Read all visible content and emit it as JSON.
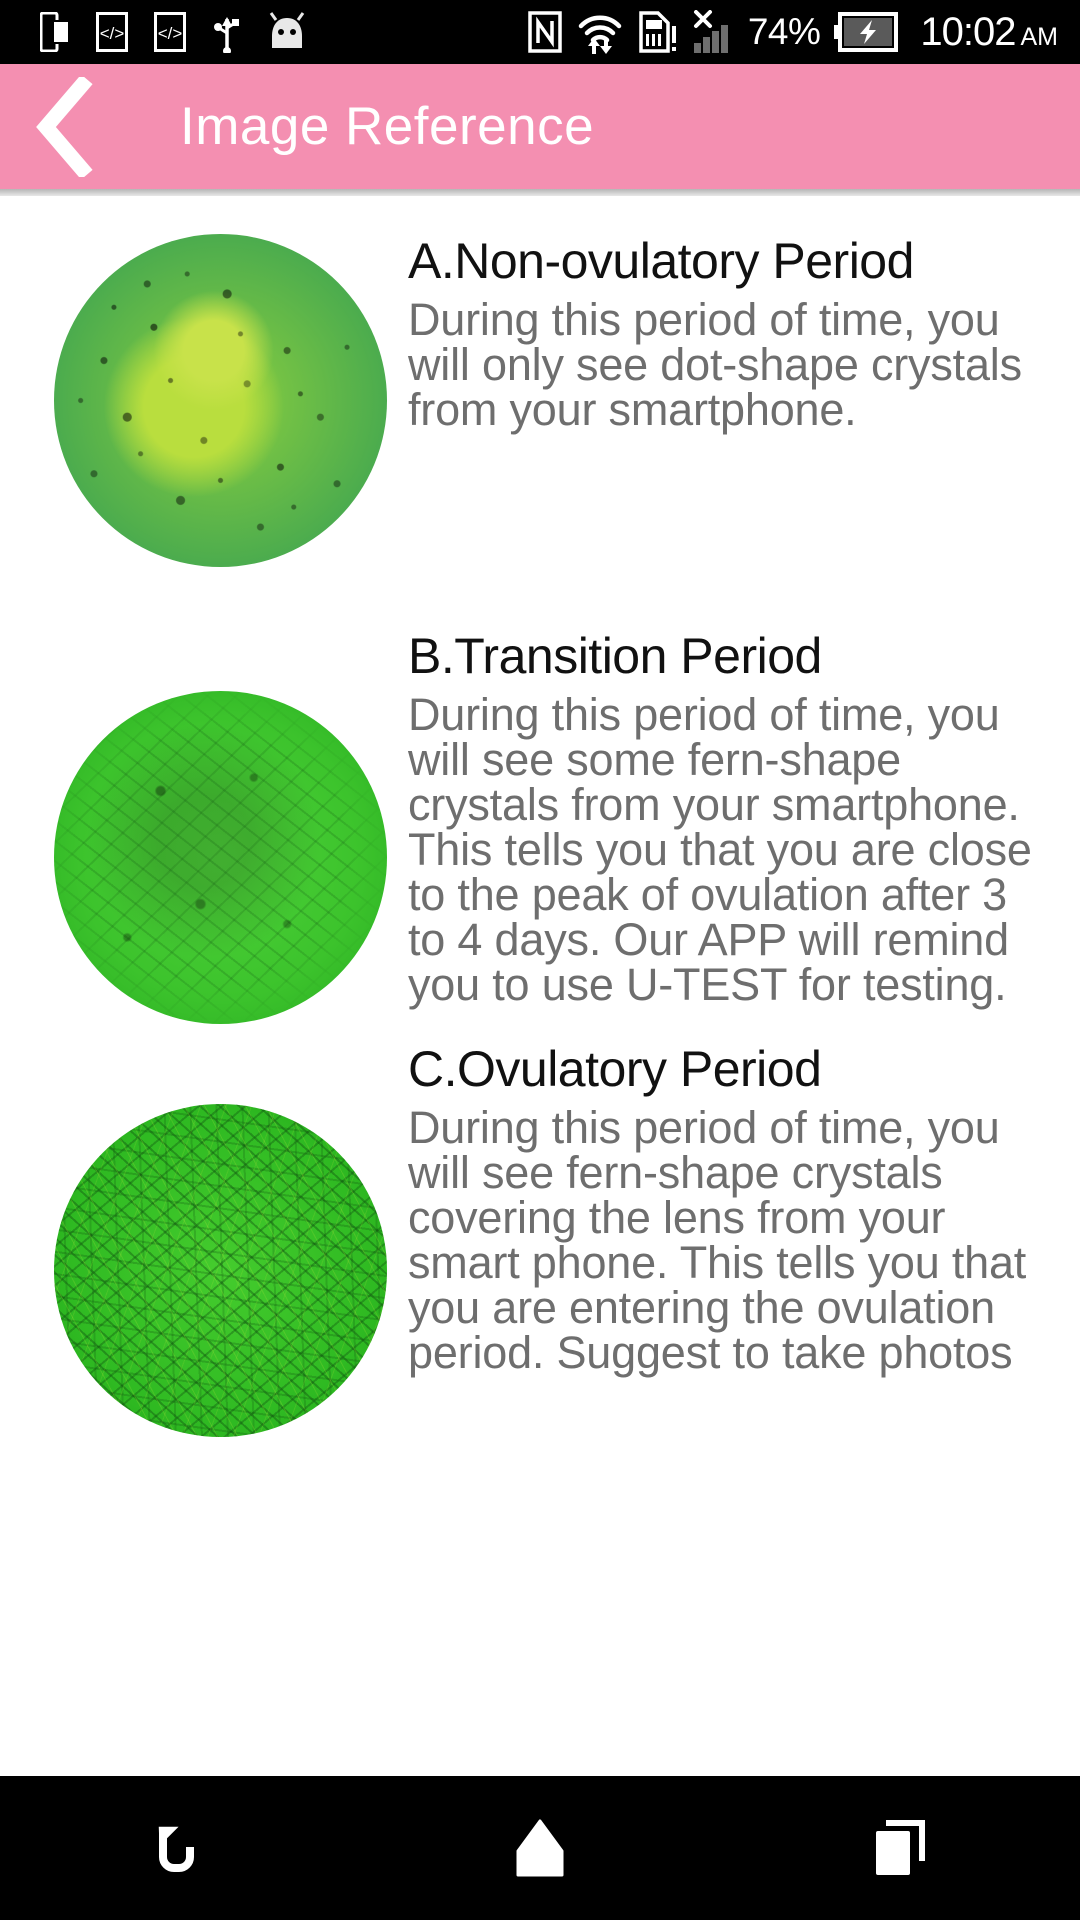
{
  "statusbar": {
    "left_icons": [
      {
        "name": "screen-mirror-icon"
      },
      {
        "name": "developer-code-icon-1"
      },
      {
        "name": "developer-code-icon-2"
      },
      {
        "name": "usb-icon"
      },
      {
        "name": "android-head-icon"
      }
    ],
    "right_icons": [
      {
        "name": "nfc-icon"
      },
      {
        "name": "wifi-data-transfer-icon"
      },
      {
        "name": "sim-card-alert-icon"
      },
      {
        "name": "signal-no-service-icon"
      }
    ],
    "battery_percent": "74%",
    "battery_icon": "battery-charging-icon",
    "time": "10:02",
    "time_period": "AM"
  },
  "appbar": {
    "back_icon": "back-chevron-icon",
    "title": "Image Reference",
    "background_color": "#f48fb1",
    "title_color": "#ffffff"
  },
  "sections": [
    {
      "image_name": "non-ovulatory-microscope-image",
      "title": "A.Non-ovulatory Period",
      "body": "During this period of time, you will only see dot-shape crystals from your smartphone."
    },
    {
      "image_name": "transition-microscope-image",
      "title": "B.Transition Period",
      "body": "During this period of time, you will see some fern-shape crystals from your smartphone. This tells you that you are close to the peak of ovulation after 3 to 4 days. Our APP will remind you to use U-TEST for testing."
    },
    {
      "image_name": "ovulatory-microscope-image",
      "title": "C.Ovulatory Period",
      "body": "During this period of time, you will see fern-shape crystals covering the lens from your smart phone. This tells you that you are entering the ovulation period. Suggest to take photos"
    }
  ],
  "navbar": {
    "buttons": [
      {
        "name": "nav-back-button",
        "icon": "back-arrow-icon"
      },
      {
        "name": "nav-home-button",
        "icon": "home-icon"
      },
      {
        "name": "nav-recents-button",
        "icon": "recent-apps-icon"
      }
    ]
  }
}
